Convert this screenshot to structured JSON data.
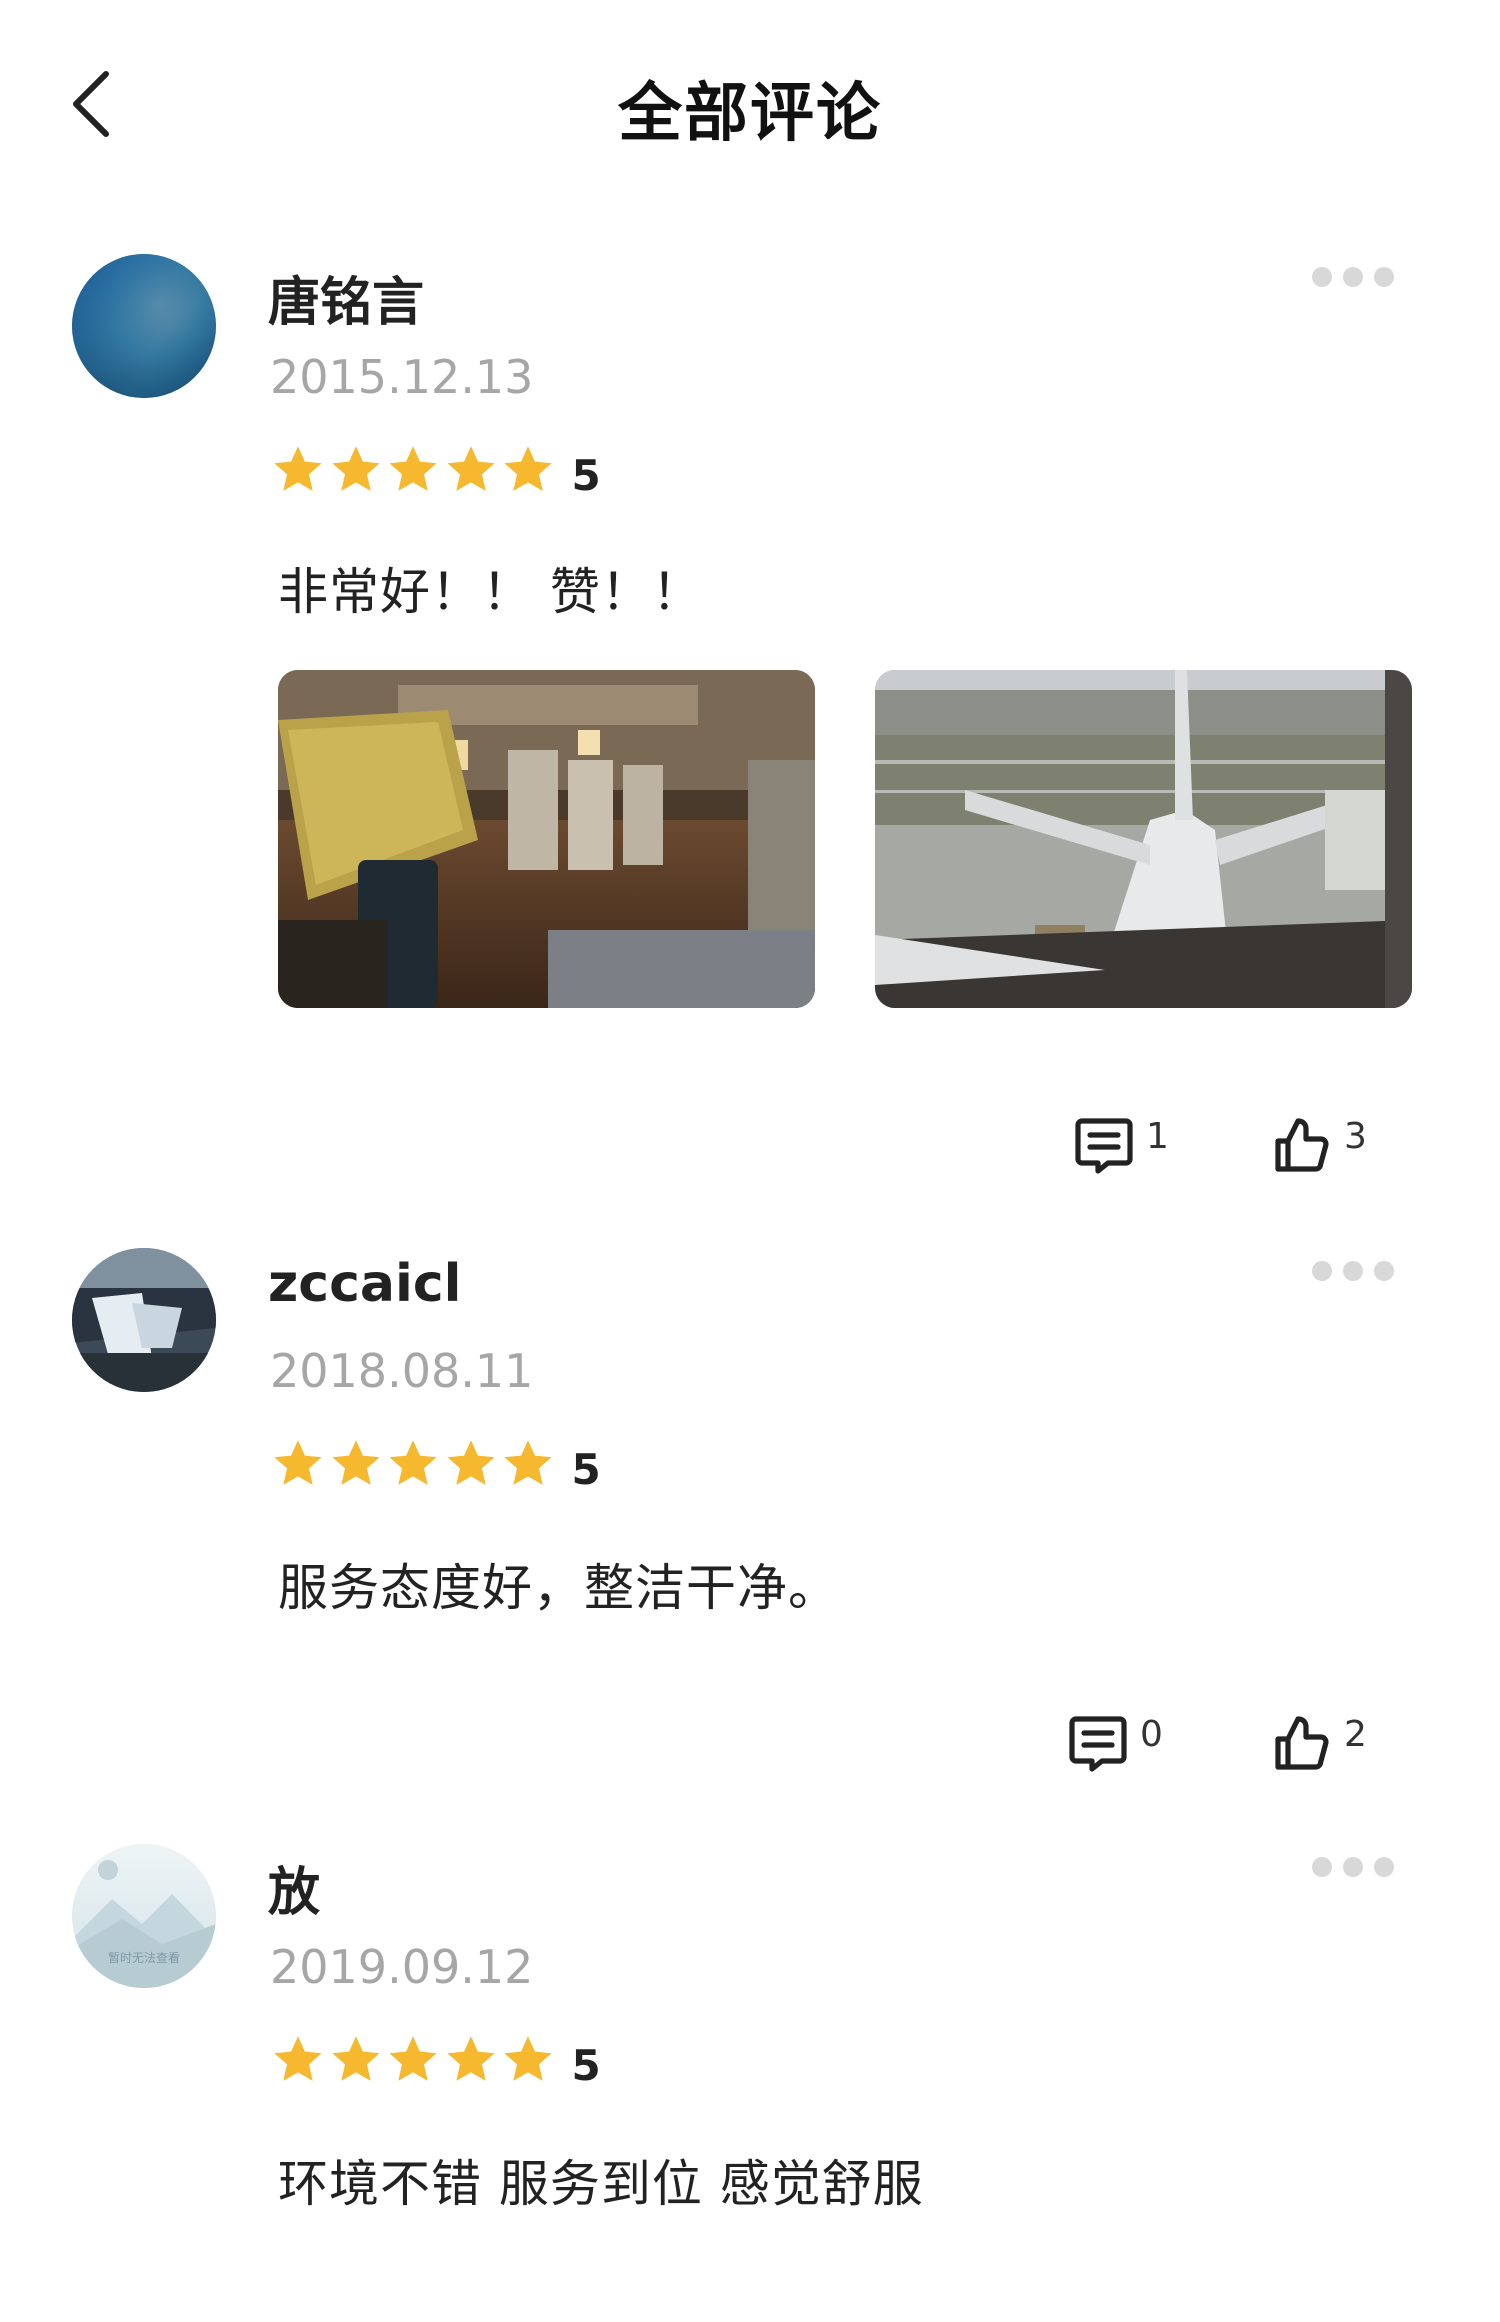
{
  "header": {
    "title": "全部评论"
  },
  "reviews": [
    {
      "username": "唐铭言",
      "date": "2015.12.13",
      "rating": 5,
      "rating_label": "5",
      "text": "非常好！！  赞！！",
      "photos": [
        "lounge-interior-photo",
        "airplane-on-tarmac-photo"
      ],
      "comment_count": "1",
      "like_count": "3"
    },
    {
      "username": "zccaicl",
      "date": "2018.08.11",
      "rating": 5,
      "rating_label": "5",
      "text": "服务态度好，整洁干净。",
      "comment_count": "0",
      "like_count": "2"
    },
    {
      "username": "放",
      "date": "2019.09.12",
      "rating": 5,
      "rating_label": "5",
      "text": "环境不错 服务到位 感觉舒服",
      "avatar_placeholder_text": "暂时无法查看"
    }
  ],
  "colors": {
    "star": "#f5b82e",
    "date": "#a6a6a6",
    "more_dots": "#d8d8d8"
  },
  "icons": [
    "chevron-left-icon",
    "more-dots-icon",
    "star-icon",
    "comment-icon",
    "thumbs-up-icon"
  ]
}
